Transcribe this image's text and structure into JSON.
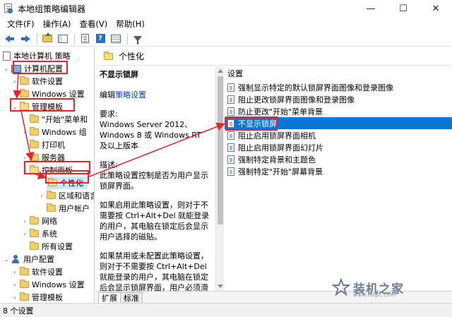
{
  "window": {
    "title": "本地组策略编辑器",
    "min_glyph": "—",
    "max_glyph": "☐",
    "close_glyph": "✕"
  },
  "menu": [
    "文件(F)",
    "操作(A)",
    "查看(V)",
    "帮助(H)"
  ],
  "toolbar_icons": [
    "back-arrow-icon",
    "forward-arrow-icon",
    "folder-up-icon",
    "show-hide-tree-icon",
    "properties-icon",
    "help-icon",
    "details-view-icon",
    "filter-icon"
  ],
  "tree": {
    "root": "本地计算机 策略",
    "computer_config": "计算机配置",
    "software_settings": "软件设置",
    "windows_settings": "Windows 设置",
    "admin_templates": "管理模板",
    "start_menu": "\"开始\"菜单和",
    "windows_components": "Windows 组",
    "printers": "打印机",
    "server": "服务器",
    "control_panel": "控制面板",
    "personalization": "个性化",
    "region_language": "区域和语言",
    "user_accounts": "用户帐户",
    "network": "网络",
    "system": "系统",
    "all_settings": "所有设置",
    "user_config": "用户配置",
    "u_software_settings": "软件设置",
    "u_windows_settings": "Windows 设置",
    "u_admin_templates": "管理模板"
  },
  "detail": {
    "header": "个性化",
    "policy_title": "不显示锁屏",
    "edit_prefix": "编辑",
    "edit_link": "策略设置",
    "requirements_label": "要求:",
    "requirements_text": "Windows Server 2012、Windows 8 或 Windows RT 及以上版本",
    "description_label": "描述:",
    "description_text": "此策略设置控制是否为用户显示锁屏界面。",
    "enabled_text": "如果启用此策略设置，则对于不需要按 Ctrl+Alt+Del 就能登录的用户，其电脑在锁定后会显示用户选择的磁贴。",
    "disabled_text": "如果禁用或未配置此策略设置，则对于不需要按 Ctrl+Alt+Del 就能登录的用户，其电脑在锁定后会显示锁屏界面，用户必须滑动才能解锁。"
  },
  "settings": {
    "header": "设置",
    "items": [
      "强制显示特定的默认锁屏界面图像和登录图像",
      "阻止更改锁屏界面图像和登录图像",
      "防止更改\"开始\"菜单背景",
      "不显示锁屏",
      "阻止启用锁屏界面相机",
      "阻止启用锁屏界面幻灯片",
      "强制特定背景和主题色",
      "强制特定\"开始\"屏幕背景"
    ],
    "selected_index": 3
  },
  "tabs": [
    "扩展",
    "标准"
  ],
  "status": "8 个设置",
  "watermark": {
    "text": "装机之家",
    "url": "www.lotpc.com"
  },
  "colors": {
    "annotation_red": "#e8232b",
    "selection_blue": "#0a75d6"
  }
}
